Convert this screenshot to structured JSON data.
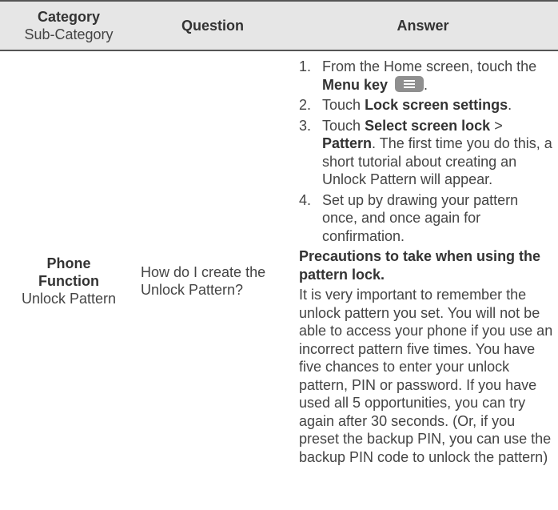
{
  "header": {
    "category": "Category",
    "sub_category": "Sub-Category",
    "question": "Question",
    "answer": "Answer"
  },
  "row": {
    "category": "Phone Function",
    "sub_category": "Unlock Pattern",
    "question": "How do I create the Unlock Pattern?",
    "steps": [
      {
        "num": "1.",
        "pre": "From the Home screen, touch the",
        "bold": "Menu key",
        "post": "."
      },
      {
        "num": "2.",
        "pre": "Touch",
        "bold": "Lock screen settings",
        "post": "."
      },
      {
        "num": "3.",
        "pre": "Touch",
        "bold": "Select screen lock",
        "mid": ">",
        "bold2": "Pattern",
        "post": ". The first time you do this, a short tutorial about creating an Unlock Pattern will appear."
      },
      {
        "num": "4.",
        "text": "Set up by drawing your pattern once, and once again for confirmation."
      }
    ],
    "precaution_title": "Precautions to take when using the pattern lock.",
    "precaution_body": "It is very important to remember the unlock pattern you set. You will not be able to access your phone if you use an incorrect pattern five times. You have five chances to enter your unlock pattern, PIN or password. If you have used all 5 opportunities, you can try again after 30 seconds. (Or, if you preset the backup PIN, you can use the backup PIN code to unlock the pattern)"
  },
  "icons": {
    "menu_key": "menu-key-icon"
  },
  "colors": {
    "header_bg": "#e6e6e6",
    "rule": "#555555",
    "menu_key_bg": "#8f8f8f"
  }
}
